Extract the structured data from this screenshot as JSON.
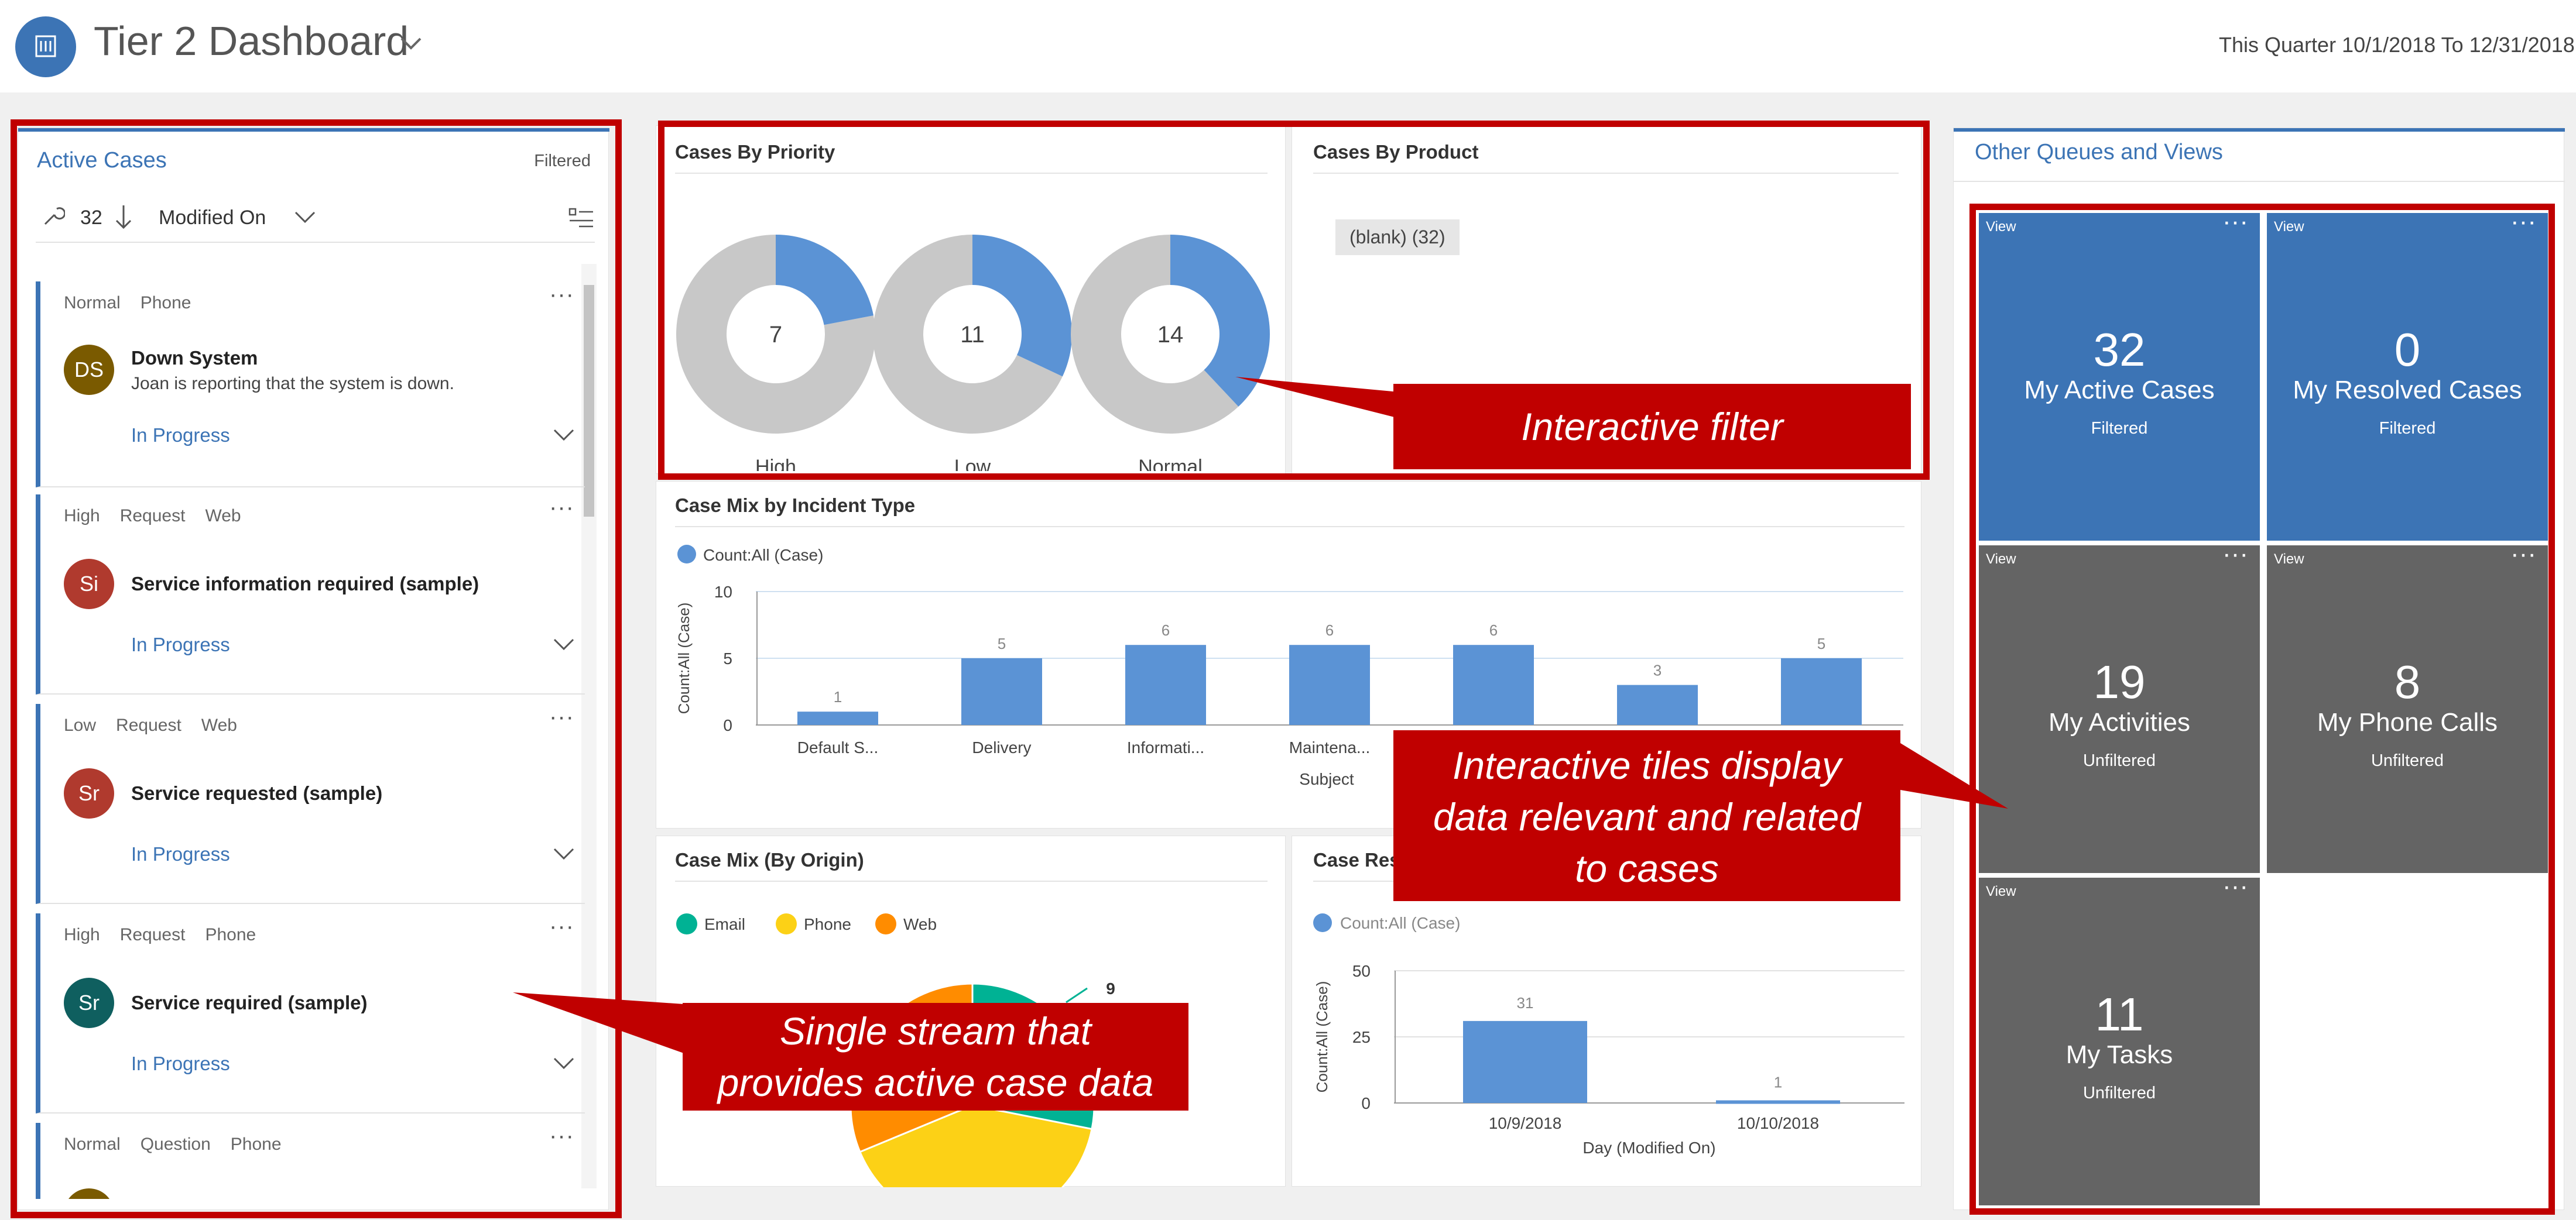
{
  "header": {
    "title": "Tier 2 Dashboard",
    "date_range": "This Quarter 10/1/2018 To 12/31/2018"
  },
  "colors": {
    "accent": "#3c74b5",
    "tile_blue": "#3c74b5",
    "tile_gray": "#646464",
    "callout_red": "#c00000",
    "donut_gray": "#c8c8c8",
    "bar_blue": "#5b93d5"
  },
  "active_cases": {
    "title": "Active Cases",
    "filter_status": "Filtered",
    "count": "32",
    "sort_field": "Modified On",
    "items": [
      {
        "tags": [
          "Normal",
          "Phone"
        ],
        "initials": "DS",
        "avatar_color": "#7a5a00",
        "title": "Down System",
        "description": "Joan is reporting that the system is down.",
        "status": "In Progress"
      },
      {
        "tags": [
          "High",
          "Request",
          "Web"
        ],
        "initials": "Si",
        "avatar_color": "#b03a2e",
        "title": "Service information required (sample)",
        "description": "",
        "status": "In Progress"
      },
      {
        "tags": [
          "Low",
          "Request",
          "Web"
        ],
        "initials": "Sr",
        "avatar_color": "#b03a2e",
        "title": "Service requested (sample)",
        "description": "",
        "status": "In Progress"
      },
      {
        "tags": [
          "High",
          "Request",
          "Phone"
        ],
        "initials": "Sr",
        "avatar_color": "#0f5f5f",
        "title": "Service required (sample)",
        "description": "",
        "status": "In Progress"
      },
      {
        "tags": [
          "Normal",
          "Question",
          "Phone"
        ],
        "initials": "",
        "avatar_color": "#7a5a00",
        "title": "",
        "description": "",
        "status": ""
      }
    ]
  },
  "cases_by_priority": {
    "title": "Cases By Priority",
    "chart_data": {
      "type": "pie",
      "donuts": [
        {
          "label": "High",
          "count": 7,
          "blue_fraction": 0.22
        },
        {
          "label": "Low",
          "count": 11,
          "blue_fraction": 0.32
        },
        {
          "label": "Normal",
          "count": 14,
          "blue_fraction": 0.38
        }
      ]
    }
  },
  "cases_by_product": {
    "title": "Cases By Product",
    "chip": "(blank) (32)"
  },
  "case_mix_incident": {
    "title": "Case Mix by Incident Type",
    "chart_data": {
      "type": "bar",
      "legend": "Count:All (Case)",
      "ylabel": "Count:All (Case)",
      "xlabel": "Subject",
      "ylim": [
        0,
        10
      ],
      "yticks": [
        0,
        5,
        10
      ],
      "categories": [
        "Default S...",
        "Delivery",
        "Informati...",
        "Maintena...",
        "",
        "",
        ""
      ],
      "values": [
        1,
        5,
        6,
        6,
        6,
        3,
        5
      ]
    }
  },
  "case_mix_origin": {
    "title": "Case Mix (By Origin)",
    "chart_data": {
      "type": "pie",
      "legend": [
        "Email",
        "Phone",
        "Web"
      ],
      "colors": [
        "#00b294",
        "#fcd116",
        "#ff8c00"
      ],
      "values": [
        9,
        13,
        10
      ]
    }
  },
  "case_resolution": {
    "title": "Case Res",
    "chart_data": {
      "type": "bar",
      "legend": "Count:All (Case)",
      "ylabel": "Count:All (Case)",
      "xlabel": "Day (Modified On)",
      "ylim": [
        0,
        50
      ],
      "yticks": [
        0,
        25,
        50
      ],
      "categories": [
        "10/9/2018",
        "10/10/2018"
      ],
      "values": [
        31,
        1
      ]
    }
  },
  "other_queues": {
    "title": "Other Queues and Views",
    "tiles": [
      {
        "view": "View",
        "count": "32",
        "label": "My Active Cases",
        "filter": "Filtered",
        "color": "#3c74b5"
      },
      {
        "view": "View",
        "count": "0",
        "label": "My Resolved Cases",
        "filter": "Filtered",
        "color": "#3c74b5"
      },
      {
        "view": "View",
        "count": "19",
        "label": "My Activities",
        "filter": "Unfiltered",
        "color": "#646464"
      },
      {
        "view": "View",
        "count": "8",
        "label": "My Phone Calls",
        "filter": "Unfiltered",
        "color": "#646464"
      },
      {
        "view": "View",
        "count": "11",
        "label": "My Tasks",
        "filter": "Unfiltered",
        "color": "#646464"
      }
    ]
  },
  "callouts": {
    "interactive_filter": "Interactive filter",
    "interactive_tiles": [
      "Interactive tiles display",
      "data relevant and related",
      "to cases"
    ],
    "single_stream": [
      "Single stream that",
      "provides active case data"
    ]
  }
}
